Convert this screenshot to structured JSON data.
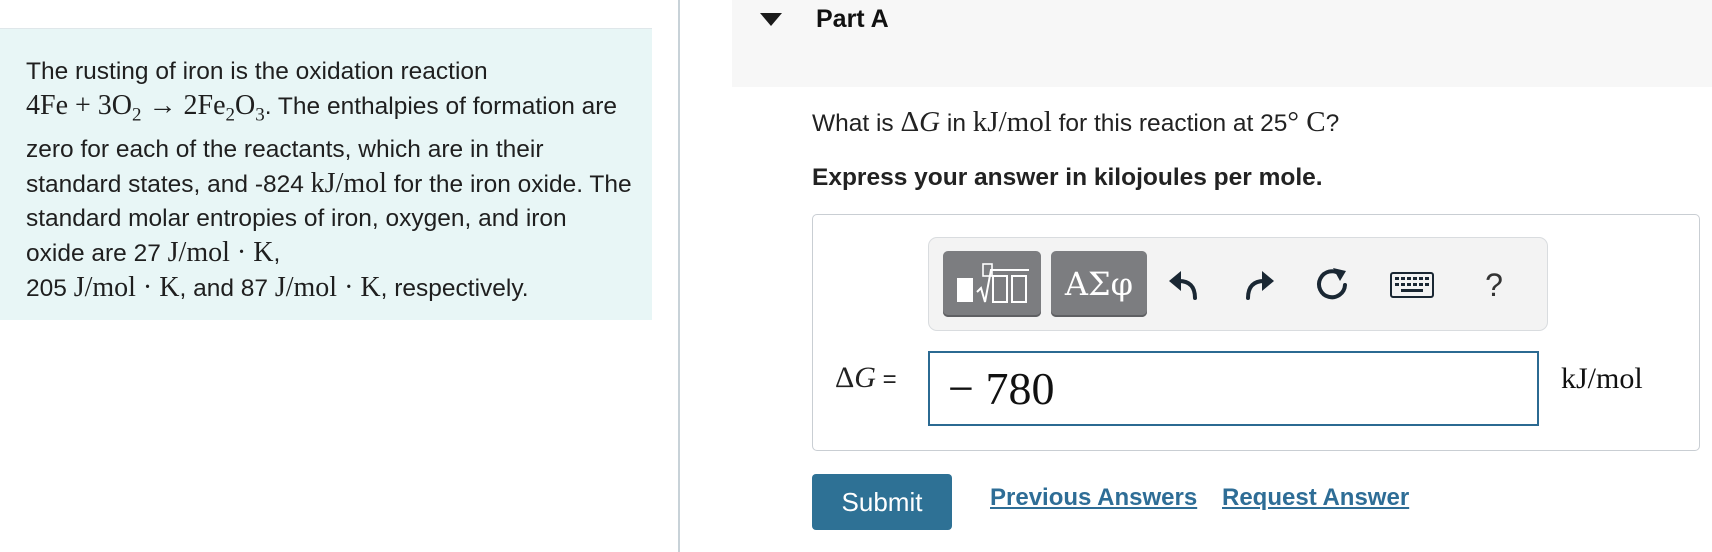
{
  "problem": {
    "intro": "The rusting of iron is the oxidation reaction",
    "equation": {
      "lhs": "4Fe + 3O",
      "o2_sub": "2",
      "arrow": " → ",
      "rhs_a": "2Fe",
      "fe_sub": "2",
      "rhs_b": "O",
      "o3_sub": "3"
    },
    "after_equation": ". The enthalpies of formation are zero for each of the reactants, which are in their standard states, and -824 ",
    "unit_kj": "kJ/mol",
    "mid1": " for the iron oxide. The standard molar entropies of iron, oxygen, and iron oxide are 27 ",
    "unit_jmolk": "J/mol · K",
    "sep1": ",",
    "val2": "205 ",
    "sep2": ", and 87 ",
    "end": ", respectively."
  },
  "part": {
    "title": "Part A"
  },
  "question": {
    "prefix": "What is ",
    "delta": "Δ",
    "g": "G",
    "mid": " in ",
    "unit": "kJ/mol",
    "mid2": " for this reaction at 25",
    "temp_unit": "° C",
    "suffix": "?"
  },
  "instruction": "Express your answer in kilojoules per mole.",
  "toolbar": {
    "greek_label": "ΑΣφ",
    "help_label": "?",
    "icons": [
      "templates-icon",
      "undo-icon",
      "redo-icon",
      "reset-icon",
      "keyboard-icon"
    ]
  },
  "answer": {
    "label_delta": "Δ",
    "label_g": "G",
    "label_eq": " =",
    "value": "− 780",
    "unit": "kJ/mol"
  },
  "actions": {
    "submit": "Submit",
    "previous_answers": "Previous Answers",
    "request_answer": "Request Answer"
  },
  "colors": {
    "panel_bg": "#e8f6f6",
    "accent": "#2e7195",
    "link": "#2e6d96",
    "input_border": "#2b6a92"
  }
}
